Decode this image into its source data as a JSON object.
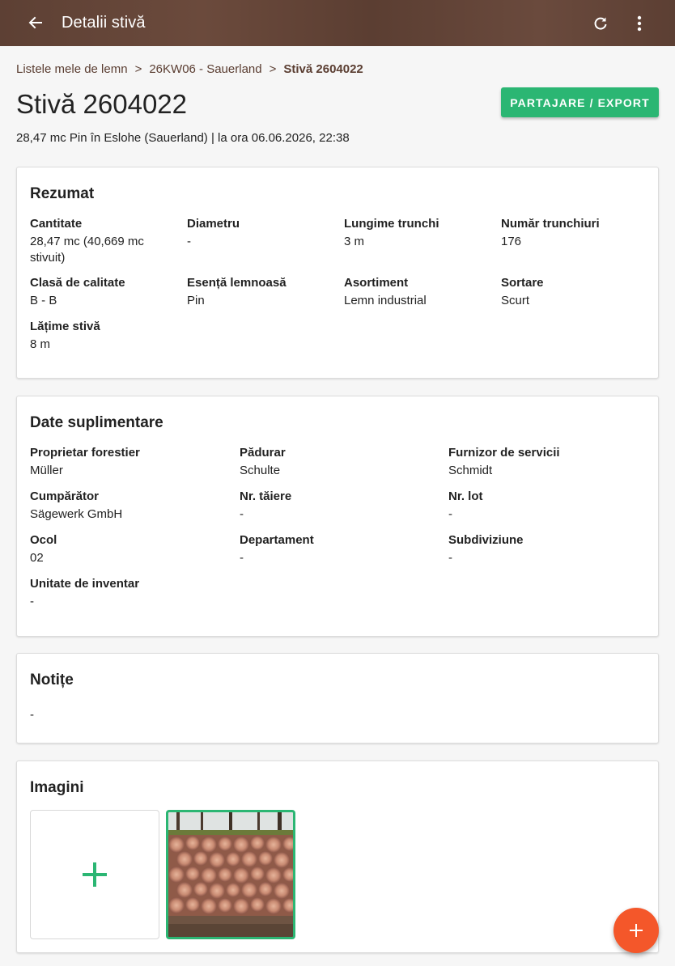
{
  "appbar": {
    "title": "Detalii stivă",
    "back_icon": "arrow-left-icon",
    "refresh_icon": "refresh-icon",
    "more_icon": "more-vertical-icon"
  },
  "breadcrumb": {
    "items": [
      "Listele mele de lemn",
      "26KW06 - Sauerland",
      "Stivă 2604022"
    ],
    "separator": ">"
  },
  "header": {
    "title": "Stivă 2604022",
    "subtitle": "28,47 mc Pin în Eslohe (Sauerland) | la ora 06.06.2026, 22:38",
    "export_label": "PARTAJARE / EXPORT"
  },
  "summary": {
    "title": "Rezumat",
    "fields": [
      {
        "label": "Cantitate",
        "value": "28,47 mc (40,669 mc stivuit)"
      },
      {
        "label": "Diametru",
        "value": "-"
      },
      {
        "label": "Lungime trunchi",
        "value": "3 m"
      },
      {
        "label": "Număr trunchiuri",
        "value": "176"
      },
      {
        "label": "Clasă de calitate",
        "value": "B - B"
      },
      {
        "label": "Esență lemnoasă",
        "value": "Pin"
      },
      {
        "label": "Asortiment",
        "value": "Lemn industrial"
      },
      {
        "label": "Sortare",
        "value": "Scurt"
      },
      {
        "label": "Lățime stivă",
        "value": "8 m"
      }
    ]
  },
  "additional": {
    "title": "Date suplimentare",
    "fields": [
      {
        "label": "Proprietar forestier",
        "value": "Müller"
      },
      {
        "label": "Pădurar",
        "value": "Schulte"
      },
      {
        "label": "Furnizor de servicii",
        "value": "Schmidt"
      },
      {
        "label": "Cumpărător",
        "value": "Sägewerk GmbH"
      },
      {
        "label": "Nr. tăiere",
        "value": "-"
      },
      {
        "label": "Nr. lot",
        "value": "-"
      },
      {
        "label": "Ocol",
        "value": "02"
      },
      {
        "label": "Departament",
        "value": "-"
      },
      {
        "label": "Subdiviziune",
        "value": "-"
      },
      {
        "label": "Unitate de inventar",
        "value": "-"
      }
    ]
  },
  "notes": {
    "title": "Notițe",
    "value": "-"
  },
  "images": {
    "title": "Imagini",
    "add_icon": "plus-icon"
  },
  "fab": {
    "icon": "plus-icon"
  },
  "colors": {
    "appbar": "#5d4034",
    "accent": "#2bb673",
    "fab": "#f4572a",
    "breadcrumb": "#5a3d31"
  }
}
